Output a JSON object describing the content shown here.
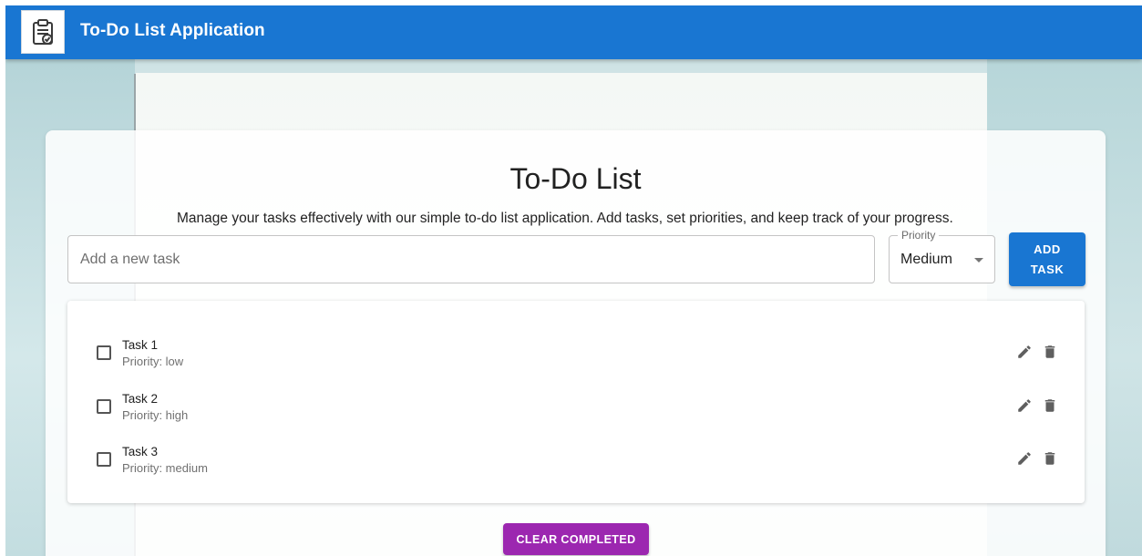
{
  "appbar": {
    "title": "To-Do List Application",
    "logo_icon": "clipboard-check-icon",
    "color": "#1976d2"
  },
  "main": {
    "heading": "To-Do List",
    "description": "Manage your tasks effectively with our simple to-do list application. Add tasks, set priorities, and keep track of your progress."
  },
  "form": {
    "task_placeholder": "Add a new task",
    "task_value": "",
    "priority_label": "Priority",
    "priority_value": "Medium",
    "add_button_line1": "ADD",
    "add_button_line2": "TASK",
    "add_button_color": "#1976d2"
  },
  "tasks": [
    {
      "name": "Task 1",
      "priority": "Priority: low",
      "completed": false
    },
    {
      "name": "Task 2",
      "priority": "Priority: high",
      "completed": false
    },
    {
      "name": "Task 3",
      "priority": "Priority: medium",
      "completed": false
    }
  ],
  "icons": {
    "edit": "pencil-icon",
    "delete": "trash-icon",
    "checkbox": "checkbox-unchecked-icon"
  },
  "footer": {
    "clear_button": "CLEAR COMPLETED",
    "clear_button_color": "#9c27b0"
  }
}
